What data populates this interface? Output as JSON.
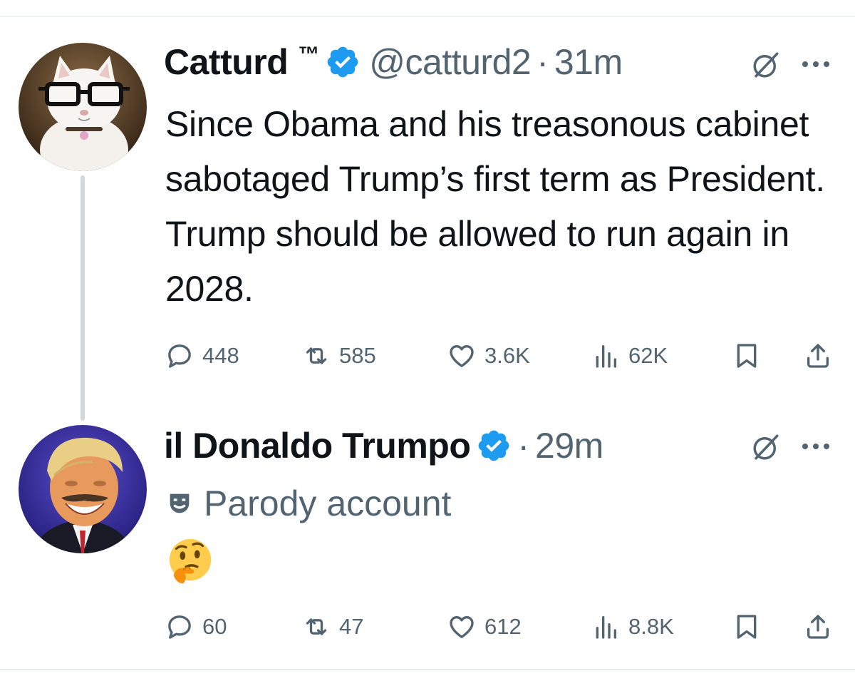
{
  "tweets": [
    {
      "name": "Catturd",
      "trademark": "™",
      "handle": "@catturd2",
      "separator": "·",
      "time": "31m",
      "avatar_icon": "cat-with-glasses-avatar",
      "text": "Since Obama and his treasonous cabinet sabotaged Trump’s first term as President. Trump should be allowed to run again in 2028.",
      "replies": "448",
      "retweets": "585",
      "likes": "3.6K",
      "views": "62K"
    },
    {
      "name": "il Donaldo Trumpo",
      "separator": "·",
      "time": "29m",
      "avatar_icon": "smiling-man-avatar",
      "label": "Parody account",
      "label_icon": "theater-mask-icon",
      "text_emoji": "thinking-face-emoji",
      "replies": "60",
      "retweets": "47",
      "likes": "612",
      "views": "8.8K"
    }
  ],
  "colors": {
    "primary_text": "#0f1419",
    "secondary_text": "#536471",
    "verified_blue": "#1d9bf0",
    "divider": "#eff3f4",
    "thread_line": "#cfd9de"
  }
}
